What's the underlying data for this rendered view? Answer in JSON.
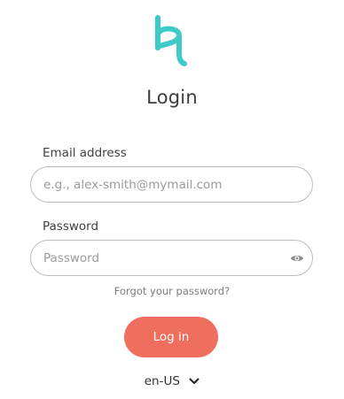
{
  "brand": {
    "logo_icon": "brand-logo-bq-icon",
    "accent_color": "#3ecbc8"
  },
  "page": {
    "title": "Login"
  },
  "form": {
    "email": {
      "label": "Email address",
      "placeholder": "e.g., alex-smith@mymail.com",
      "value": ""
    },
    "password": {
      "label": "Password",
      "placeholder": "Password",
      "value": "",
      "toggle_icon": "eye-icon"
    },
    "forgot_link": "Forgot your password?",
    "submit_label": "Log in",
    "submit_color": "#f06e5d"
  },
  "locale": {
    "selected": "en-US",
    "icon": "chevron-down-icon"
  }
}
